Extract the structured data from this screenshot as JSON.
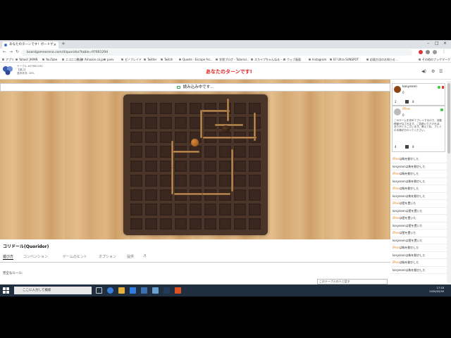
{
  "browser": {
    "tab_title": "あなたのターンです！ボードゲ",
    "new_tab": "+",
    "url": "boardgamearena.com/4/quoridor?table=97661294",
    "bookmarks": [
      "アプリ",
      "Yahoo! JAPAN",
      "YouTube",
      "ニコニコ動画",
      "Amazon.co.jp",
      "pixiv",
      "ゼノブレイド",
      "Twitter",
      "Twitch",
      "Quests - Escape fro...",
      "学習ブログ - Tutorial...",
      "スカイプちゃんねる - ...",
      "ウェブ画面",
      "Instagram",
      "EF Ultra SUNSPOT",
      "応援方法のお知らせ...",
      "その他のブックマーク"
    ]
  },
  "site": {
    "table_info": [
      "テーブル #97661294",
      "【遊ぶ】",
      "進捗状況: 18%"
    ],
    "turn_message": "あなたのターンです!"
  },
  "loading": {
    "text": "読み込み中です..."
  },
  "game": {
    "title": "コリドール(Quoridor)",
    "tabs": [
      "遊び方",
      "コンベンション",
      "ゲームのヒント",
      "オプション",
      "提供",
      "♬"
    ],
    "rules_label": "完全なルール:"
  },
  "players": [
    {
      "name": "kosyesen",
      "score": "0",
      "walls": "2",
      "walls_right": "8",
      "color": "#8b4513"
    },
    {
      "name": "iPine",
      "score": "0",
      "walls": "4",
      "walls_right": "8",
      "color": "#e07b10",
      "message": "このゲームを初めてプレイするので、自動移動がなされます。ご容赦いただければ、ありがとうございます。教えてね、プレイの手順が分かってください。"
    }
  ],
  "log": [
    {
      "who": "iPine",
      "text": "は駒を動かした",
      "side": "b"
    },
    {
      "who": "kosyesen",
      "text": "は駒を動かした",
      "side": "a"
    },
    {
      "who": "iPine",
      "text": "は駒を動かした",
      "side": "b"
    },
    {
      "who": "kosyesen",
      "text": "は駒を動かした",
      "side": "a"
    },
    {
      "who": "iPine",
      "text": "は駒を動かした",
      "side": "b"
    },
    {
      "who": "kosyesen",
      "text": "は駒を動かした",
      "side": "a"
    },
    {
      "who": "iPine",
      "text": "は壁を置いた",
      "side": "b"
    },
    {
      "who": "kosyesen",
      "text": "は壁を置いた",
      "side": "a"
    },
    {
      "who": "iPine",
      "text": "は壁を置いた",
      "side": "b"
    },
    {
      "who": "kosyesen",
      "text": "は壁を置いた",
      "side": "a"
    },
    {
      "who": "iPine",
      "text": "は壁を置いた",
      "side": "b"
    },
    {
      "who": "kosyesen",
      "text": "は壁を置いた",
      "side": "a"
    },
    {
      "who": "iPine",
      "text": "は駒を動かした",
      "side": "b"
    },
    {
      "who": "kosyesen",
      "text": "は駒を動かした",
      "side": "a"
    },
    {
      "who": "iPine",
      "text": "は駒を動かした",
      "side": "b"
    },
    {
      "who": "kosyesen",
      "text": "は駒を動かした",
      "side": "a"
    }
  ],
  "chat_placeholder": "このテーブルの人と話す",
  "taskbar": {
    "search": "ここに入力して検索",
    "time": "17:18",
    "date": "2020/05/30"
  },
  "colors": {
    "turn_red": "#e02020",
    "board_dark": "#4b3428",
    "wall": "#c99a60",
    "wood": "#dcb17c"
  }
}
